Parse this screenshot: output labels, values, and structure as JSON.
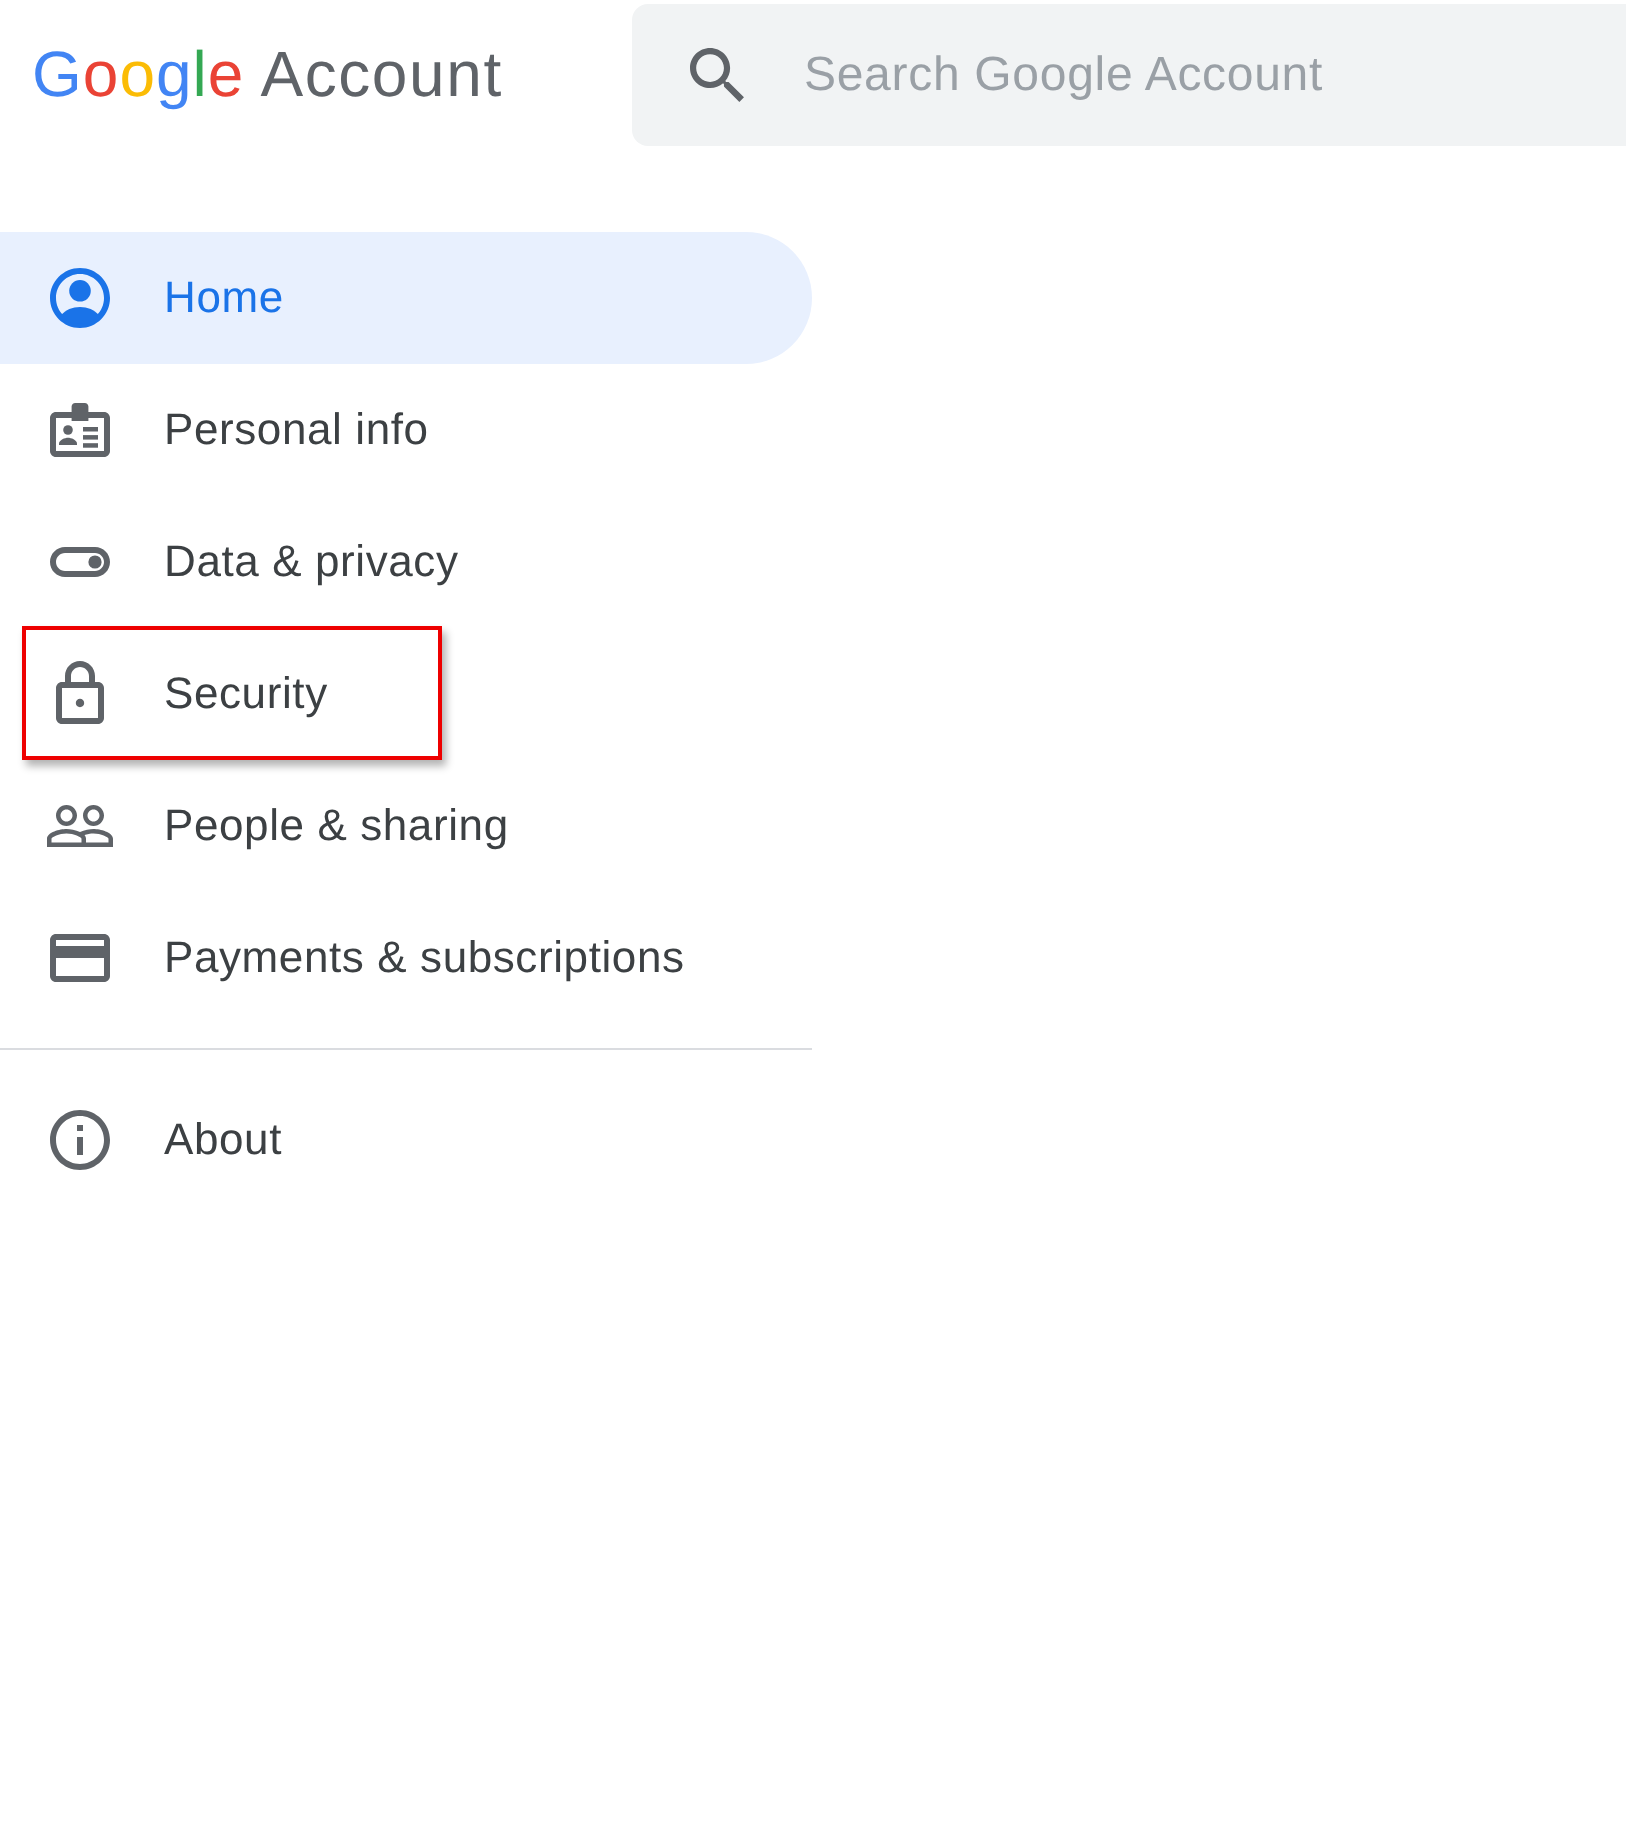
{
  "header": {
    "logo": {
      "brand": "Google",
      "product": "Account"
    },
    "search": {
      "placeholder": "Search Google Account"
    }
  },
  "nav": [
    {
      "kind": "home",
      "label": "Home",
      "selected": true,
      "highlighted": false
    },
    {
      "kind": "profile",
      "label": "Personal info",
      "selected": false,
      "highlighted": false
    },
    {
      "kind": "privacy",
      "label": "Data & privacy",
      "selected": false,
      "highlighted": false
    },
    {
      "kind": "security",
      "label": "Security",
      "selected": false,
      "highlighted": true
    },
    {
      "kind": "sharing",
      "label": "People & sharing",
      "selected": false,
      "highlighted": false
    },
    {
      "kind": "payments",
      "label": "Payments & subscriptions",
      "selected": false,
      "highlighted": false
    }
  ],
  "secondary_nav": [
    {
      "kind": "about",
      "label": "About",
      "selected": false,
      "highlighted": false
    }
  ]
}
